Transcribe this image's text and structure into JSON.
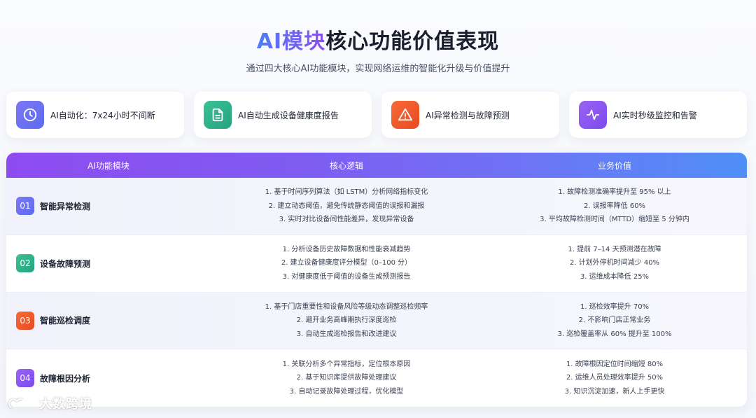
{
  "header": {
    "title_highlight": "AI模块",
    "title_rest": "核心功能价值表现",
    "subtitle": "通过四大核心AI功能模块，实现网络运维的智能化升级与价值提升"
  },
  "feature_cards": [
    {
      "label": "AI自动化：7x24小时不间断",
      "icon": "clock-icon",
      "color": "#6a6ff2"
    },
    {
      "label": "AI自动生成设备健康度报告",
      "icon": "document-icon",
      "color": "#2fb48c"
    },
    {
      "label": "AI异常检测与故障预测",
      "icon": "warning-icon",
      "color": "#f05a2c"
    },
    {
      "label": "AI实时秒级监控和告警",
      "icon": "pulse-icon",
      "color": "#8a55f0"
    }
  ],
  "table": {
    "headers": [
      "AI功能模块",
      "核心逻辑",
      "业务价值"
    ],
    "rows": [
      {
        "num": "01",
        "name": "智能异常检测",
        "badge_color": "#6b6ff2",
        "logic": [
          "1. 基于时间序列算法（如 LSTM）分析网络指标变化",
          "2. 建立动态阈值，避免传统静态阈值的误报和漏报",
          "3. 实时对比设备间性能差异，发现异常设备"
        ],
        "value": [
          "1. 故障检测准确率提升至 95% 以上",
          "2. 误报率降低 60%",
          "3. 平均故障检测时间（MTTD）缩短至 5 分钟内"
        ]
      },
      {
        "num": "02",
        "name": "设备故障预测",
        "badge_color": "#2fb48c",
        "logic": [
          "1. 分析设备历史故障数据和性能衰减趋势",
          "2. 建立设备健康度评分模型（0–100 分）",
          "3. 对健康度低于阈值的设备生成预测报告"
        ],
        "value": [
          "1. 提前 7–14 天预测潜在故障",
          "2. 计划外停机时间减少 40%",
          "3. 运维成本降低 25%"
        ]
      },
      {
        "num": "03",
        "name": "智能巡检调度",
        "badge_color": "#f05a2c",
        "logic": [
          "1. 基于门店重要性和设备风险等级动态调整巡检频率",
          "2. 避开业务高峰期执行深度巡检",
          "3. 自动生成巡检报告和改进建议"
        ],
        "value": [
          "1. 巡检效率提升 70%",
          "2. 不影响门店正常业务",
          "3. 巡检覆盖率从 60% 提升至 100%"
        ]
      },
      {
        "num": "04",
        "name": "故障根因分析",
        "badge_color": "#8a55f0",
        "logic": [
          "1. 关联分析多个异常指标，定位根本原因",
          "2. 基于知识库提供故障处理建议",
          "3. 自动记录故障处理过程，优化模型"
        ],
        "value": [
          "1. 故障根因定位时间缩短 80%",
          "2. 运维人员处理效率提升 50%",
          "3. 知识沉淀加速，新人上手更快"
        ]
      }
    ]
  },
  "watermark": {
    "text": "大数跨境"
  }
}
